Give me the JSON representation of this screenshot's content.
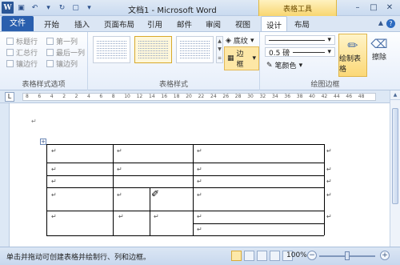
{
  "titlebar": {
    "title": "文档1 - Microsoft Word",
    "context_group": "表格工具"
  },
  "tabs": {
    "file": "文件",
    "items": [
      "开始",
      "插入",
      "页面布局",
      "引用",
      "邮件",
      "审阅",
      "视图",
      "设计",
      "布局"
    ],
    "active": "设计"
  },
  "ribbon": {
    "style_options": {
      "label": "表格样式选项",
      "options": [
        "标题行",
        "第一列",
        "汇总行",
        "最后一列",
        "镶边行",
        "镶边列"
      ]
    },
    "table_styles": {
      "label": "表格样式"
    },
    "shading_label": "底纹",
    "border_label": "边框",
    "line_weight": "0.5 磅",
    "pen_color_label": "笔颜色",
    "draw_borders": {
      "label": "绘图边框",
      "draw_table": "绘制表格",
      "eraser": "擦除"
    }
  },
  "ruler": {
    "marks": [
      "8",
      "6",
      "4",
      "2",
      "2",
      "4",
      "6",
      "8",
      "10",
      "12",
      "14",
      "16",
      "18",
      "20",
      "22",
      "24",
      "26",
      "28",
      "30",
      "32",
      "34",
      "36",
      "38",
      "40",
      "42",
      "44",
      "46",
      "48"
    ]
  },
  "document": {
    "paragraph_mark": "↵",
    "cell_mark": "↵"
  },
  "statusbar": {
    "hint": "单击并拖动可创建表格并绘制行、列和边框。",
    "zoom": "100%"
  },
  "colors": {
    "file_tab": "#2a5fae",
    "context_tab": "#f8d670",
    "ribbon_bg": "#e6eefa",
    "active_button": "#fbd877"
  }
}
